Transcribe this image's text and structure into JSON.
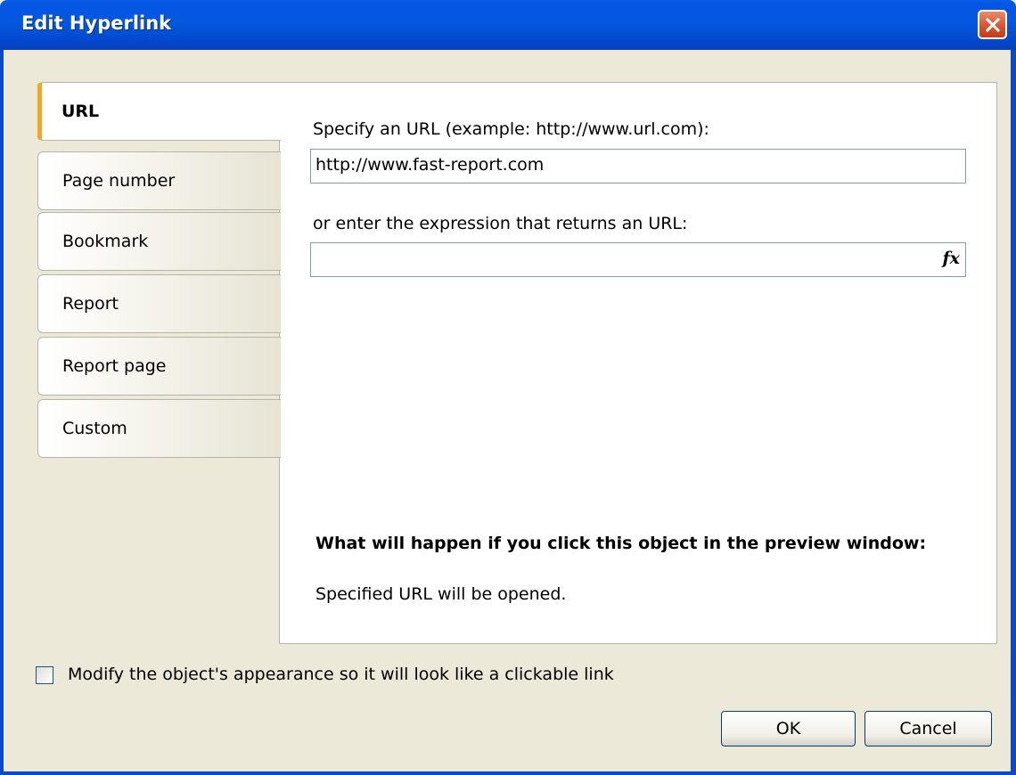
{
  "window": {
    "title": "Edit Hyperlink"
  },
  "tabs": [
    {
      "label": "URL",
      "active": true
    },
    {
      "label": "Page number",
      "active": false
    },
    {
      "label": "Bookmark",
      "active": false
    },
    {
      "label": "Report",
      "active": false
    },
    {
      "label": "Report page",
      "active": false
    },
    {
      "label": "Custom",
      "active": false
    }
  ],
  "url_panel": {
    "url_label": "Specify an URL (example: http://www.url.com):",
    "url_value": "http://www.fast-report.com",
    "expression_label": "or enter the expression that returns an URL:",
    "expression_value": "",
    "fx_icon": "fx-icon",
    "fx_text": "fx",
    "info_heading": "What will happen if you click this object in the preview window:",
    "info_text": "Specified URL will be opened."
  },
  "appearance_checkbox": {
    "label": "Modify the object's appearance so it will look like a clickable link",
    "checked": false
  },
  "buttons": {
    "ok": "OK",
    "cancel": "Cancel"
  },
  "colors": {
    "titlebar": "#0358dd",
    "dialog_bg": "#ece9d8",
    "tab_accent": "#f5a623",
    "close_button": "#d6502c"
  }
}
